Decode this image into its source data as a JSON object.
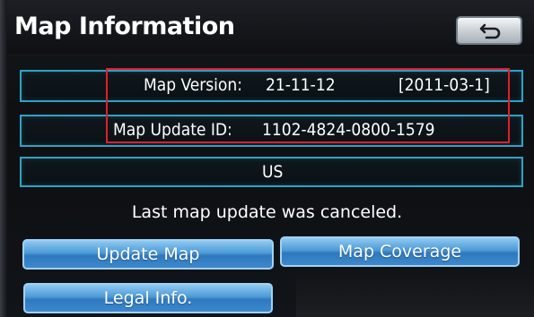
{
  "header": {
    "title": "Map Information",
    "back_icon": "back-arrow-icon"
  },
  "info": {
    "version_label": "Map Version:",
    "version_value": "21-11-12",
    "version_date": "[2011-03-1]",
    "update_id_label": "Map Update ID:",
    "update_id_value": "1102-4824-0800-1579",
    "region": "US"
  },
  "status": "Last map update was canceled.",
  "buttons": {
    "update_map": "Update Map",
    "map_coverage": "Map Coverage",
    "legal_info": "Legal Info."
  },
  "colors": {
    "row_border": "#2fa2c6",
    "button_blue": "#3d88cc",
    "highlight_red": "#e01f2c"
  }
}
